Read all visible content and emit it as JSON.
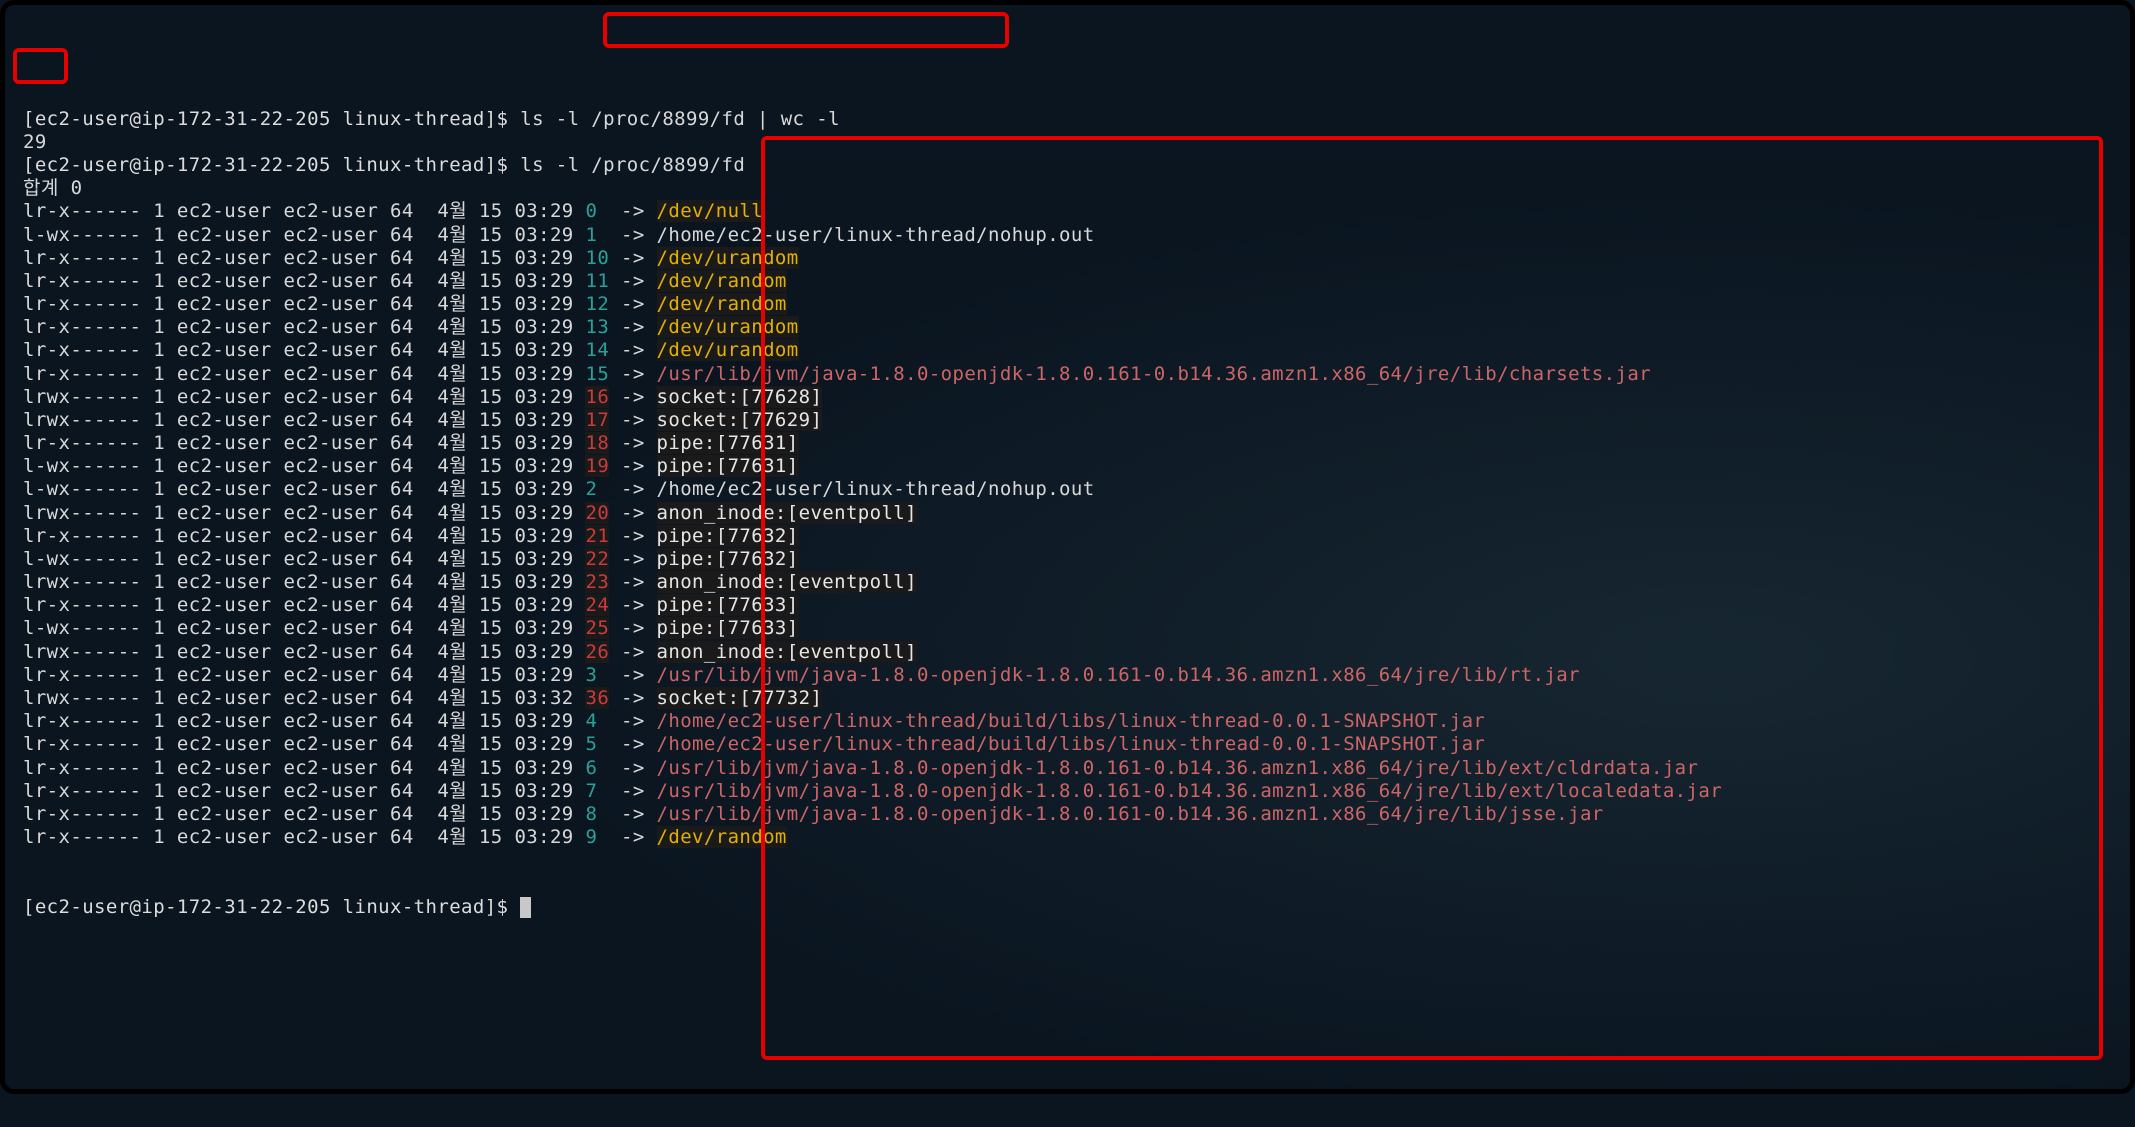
{
  "prompt_text": "[ec2-user@ip-172-31-22-205 linux-thread]$ ",
  "cmd1": "ls -l /proc/8899/fd | wc -l",
  "count_output": "29",
  "cmd2": "ls -l /proc/8899/fd",
  "total_line": "합계 0",
  "fd_listing": [
    {
      "perm": "lr-x------",
      "links": "1",
      "user": "ec2-user",
      "group": "ec2-user",
      "size": "64",
      "month": " 4월",
      "day": "15",
      "time": "03:29",
      "fd": "0",
      "fd_color": "cyan",
      "target": "/dev/null",
      "target_style": "yellow"
    },
    {
      "perm": "l-wx------",
      "links": "1",
      "user": "ec2-user",
      "group": "ec2-user",
      "size": "64",
      "month": " 4월",
      "day": "15",
      "time": "03:29",
      "fd": "1",
      "fd_color": "cyan",
      "target": "/home/ec2-user/linux-thread/nohup.out",
      "target_style": "plain"
    },
    {
      "perm": "lr-x------",
      "links": "1",
      "user": "ec2-user",
      "group": "ec2-user",
      "size": "64",
      "month": " 4월",
      "day": "15",
      "time": "03:29",
      "fd": "10",
      "fd_color": "cyan",
      "target": "/dev/urandom",
      "target_style": "yellow"
    },
    {
      "perm": "lr-x------",
      "links": "1",
      "user": "ec2-user",
      "group": "ec2-user",
      "size": "64",
      "month": " 4월",
      "day": "15",
      "time": "03:29",
      "fd": "11",
      "fd_color": "cyan",
      "target": "/dev/random",
      "target_style": "yellow"
    },
    {
      "perm": "lr-x------",
      "links": "1",
      "user": "ec2-user",
      "group": "ec2-user",
      "size": "64",
      "month": " 4월",
      "day": "15",
      "time": "03:29",
      "fd": "12",
      "fd_color": "cyan",
      "target": "/dev/random",
      "target_style": "yellow"
    },
    {
      "perm": "lr-x------",
      "links": "1",
      "user": "ec2-user",
      "group": "ec2-user",
      "size": "64",
      "month": " 4월",
      "day": "15",
      "time": "03:29",
      "fd": "13",
      "fd_color": "cyan",
      "target": "/dev/urandom",
      "target_style": "yellow"
    },
    {
      "perm": "lr-x------",
      "links": "1",
      "user": "ec2-user",
      "group": "ec2-user",
      "size": "64",
      "month": " 4월",
      "day": "15",
      "time": "03:29",
      "fd": "14",
      "fd_color": "cyan",
      "target": "/dev/urandom",
      "target_style": "yellow"
    },
    {
      "perm": "lr-x------",
      "links": "1",
      "user": "ec2-user",
      "group": "ec2-user",
      "size": "64",
      "month": " 4월",
      "day": "15",
      "time": "03:29",
      "fd": "15",
      "fd_color": "cyan",
      "target": "/usr/lib/jvm/java-1.8.0-openjdk-1.8.0.161-0.b14.36.amzn1.x86_64/jre/lib/charsets.jar",
      "target_style": "red"
    },
    {
      "perm": "lrwx------",
      "links": "1",
      "user": "ec2-user",
      "group": "ec2-user",
      "size": "64",
      "month": " 4월",
      "day": "15",
      "time": "03:29",
      "fd": "16",
      "fd_color": "red",
      "target": "socket:[77628]",
      "target_style": "white"
    },
    {
      "perm": "lrwx------",
      "links": "1",
      "user": "ec2-user",
      "group": "ec2-user",
      "size": "64",
      "month": " 4월",
      "day": "15",
      "time": "03:29",
      "fd": "17",
      "fd_color": "red",
      "target": "socket:[77629]",
      "target_style": "white"
    },
    {
      "perm": "lr-x------",
      "links": "1",
      "user": "ec2-user",
      "group": "ec2-user",
      "size": "64",
      "month": " 4월",
      "day": "15",
      "time": "03:29",
      "fd": "18",
      "fd_color": "red",
      "target": "pipe:[77631]",
      "target_style": "white"
    },
    {
      "perm": "l-wx------",
      "links": "1",
      "user": "ec2-user",
      "group": "ec2-user",
      "size": "64",
      "month": " 4월",
      "day": "15",
      "time": "03:29",
      "fd": "19",
      "fd_color": "red",
      "target": "pipe:[77631]",
      "target_style": "white"
    },
    {
      "perm": "l-wx------",
      "links": "1",
      "user": "ec2-user",
      "group": "ec2-user",
      "size": "64",
      "month": " 4월",
      "day": "15",
      "time": "03:29",
      "fd": "2",
      "fd_color": "cyan",
      "target": "/home/ec2-user/linux-thread/nohup.out",
      "target_style": "plain"
    },
    {
      "perm": "lrwx------",
      "links": "1",
      "user": "ec2-user",
      "group": "ec2-user",
      "size": "64",
      "month": " 4월",
      "day": "15",
      "time": "03:29",
      "fd": "20",
      "fd_color": "red",
      "target": "anon_inode:[eventpoll]",
      "target_style": "white"
    },
    {
      "perm": "lr-x------",
      "links": "1",
      "user": "ec2-user",
      "group": "ec2-user",
      "size": "64",
      "month": " 4월",
      "day": "15",
      "time": "03:29",
      "fd": "21",
      "fd_color": "red",
      "target": "pipe:[77632]",
      "target_style": "white"
    },
    {
      "perm": "l-wx------",
      "links": "1",
      "user": "ec2-user",
      "group": "ec2-user",
      "size": "64",
      "month": " 4월",
      "day": "15",
      "time": "03:29",
      "fd": "22",
      "fd_color": "red",
      "target": "pipe:[77632]",
      "target_style": "white"
    },
    {
      "perm": "lrwx------",
      "links": "1",
      "user": "ec2-user",
      "group": "ec2-user",
      "size": "64",
      "month": " 4월",
      "day": "15",
      "time": "03:29",
      "fd": "23",
      "fd_color": "red",
      "target": "anon_inode:[eventpoll]",
      "target_style": "white"
    },
    {
      "perm": "lr-x------",
      "links": "1",
      "user": "ec2-user",
      "group": "ec2-user",
      "size": "64",
      "month": " 4월",
      "day": "15",
      "time": "03:29",
      "fd": "24",
      "fd_color": "red",
      "target": "pipe:[77633]",
      "target_style": "white"
    },
    {
      "perm": "l-wx------",
      "links": "1",
      "user": "ec2-user",
      "group": "ec2-user",
      "size": "64",
      "month": " 4월",
      "day": "15",
      "time": "03:29",
      "fd": "25",
      "fd_color": "red",
      "target": "pipe:[77633]",
      "target_style": "white"
    },
    {
      "perm": "lrwx------",
      "links": "1",
      "user": "ec2-user",
      "group": "ec2-user",
      "size": "64",
      "month": " 4월",
      "day": "15",
      "time": "03:29",
      "fd": "26",
      "fd_color": "red",
      "target": "anon_inode:[eventpoll]",
      "target_style": "white"
    },
    {
      "perm": "lr-x------",
      "links": "1",
      "user": "ec2-user",
      "group": "ec2-user",
      "size": "64",
      "month": " 4월",
      "day": "15",
      "time": "03:29",
      "fd": "3",
      "fd_color": "cyan",
      "target": "/usr/lib/jvm/java-1.8.0-openjdk-1.8.0.161-0.b14.36.amzn1.x86_64/jre/lib/rt.jar",
      "target_style": "red"
    },
    {
      "perm": "lrwx------",
      "links": "1",
      "user": "ec2-user",
      "group": "ec2-user",
      "size": "64",
      "month": " 4월",
      "day": "15",
      "time": "03:32",
      "fd": "36",
      "fd_color": "red",
      "target": "socket:[77732]",
      "target_style": "white"
    },
    {
      "perm": "lr-x------",
      "links": "1",
      "user": "ec2-user",
      "group": "ec2-user",
      "size": "64",
      "month": " 4월",
      "day": "15",
      "time": "03:29",
      "fd": "4",
      "fd_color": "cyan",
      "target": "/home/ec2-user/linux-thread/build/libs/linux-thread-0.0.1-SNAPSHOT.jar",
      "target_style": "red"
    },
    {
      "perm": "lr-x------",
      "links": "1",
      "user": "ec2-user",
      "group": "ec2-user",
      "size": "64",
      "month": " 4월",
      "day": "15",
      "time": "03:29",
      "fd": "5",
      "fd_color": "cyan",
      "target": "/home/ec2-user/linux-thread/build/libs/linux-thread-0.0.1-SNAPSHOT.jar",
      "target_style": "red"
    },
    {
      "perm": "lr-x------",
      "links": "1",
      "user": "ec2-user",
      "group": "ec2-user",
      "size": "64",
      "month": " 4월",
      "day": "15",
      "time": "03:29",
      "fd": "6",
      "fd_color": "cyan",
      "target": "/usr/lib/jvm/java-1.8.0-openjdk-1.8.0.161-0.b14.36.amzn1.x86_64/jre/lib/ext/cldrdata.jar",
      "target_style": "red"
    },
    {
      "perm": "lr-x------",
      "links": "1",
      "user": "ec2-user",
      "group": "ec2-user",
      "size": "64",
      "month": " 4월",
      "day": "15",
      "time": "03:29",
      "fd": "7",
      "fd_color": "cyan",
      "target": "/usr/lib/jvm/java-1.8.0-openjdk-1.8.0.161-0.b14.36.amzn1.x86_64/jre/lib/ext/localedata.jar",
      "target_style": "red"
    },
    {
      "perm": "lr-x------",
      "links": "1",
      "user": "ec2-user",
      "group": "ec2-user",
      "size": "64",
      "month": " 4월",
      "day": "15",
      "time": "03:29",
      "fd": "8",
      "fd_color": "cyan",
      "target": "/usr/lib/jvm/java-1.8.0-openjdk-1.8.0.161-0.b14.36.amzn1.x86_64/jre/lib/jsse.jar",
      "target_style": "red"
    },
    {
      "perm": "lr-x------",
      "links": "1",
      "user": "ec2-user",
      "group": "ec2-user",
      "size": "64",
      "month": " 4월",
      "day": "15",
      "time": "03:29",
      "fd": "9",
      "fd_color": "cyan",
      "target": "/dev/random",
      "target_style": "yellow"
    }
  ]
}
